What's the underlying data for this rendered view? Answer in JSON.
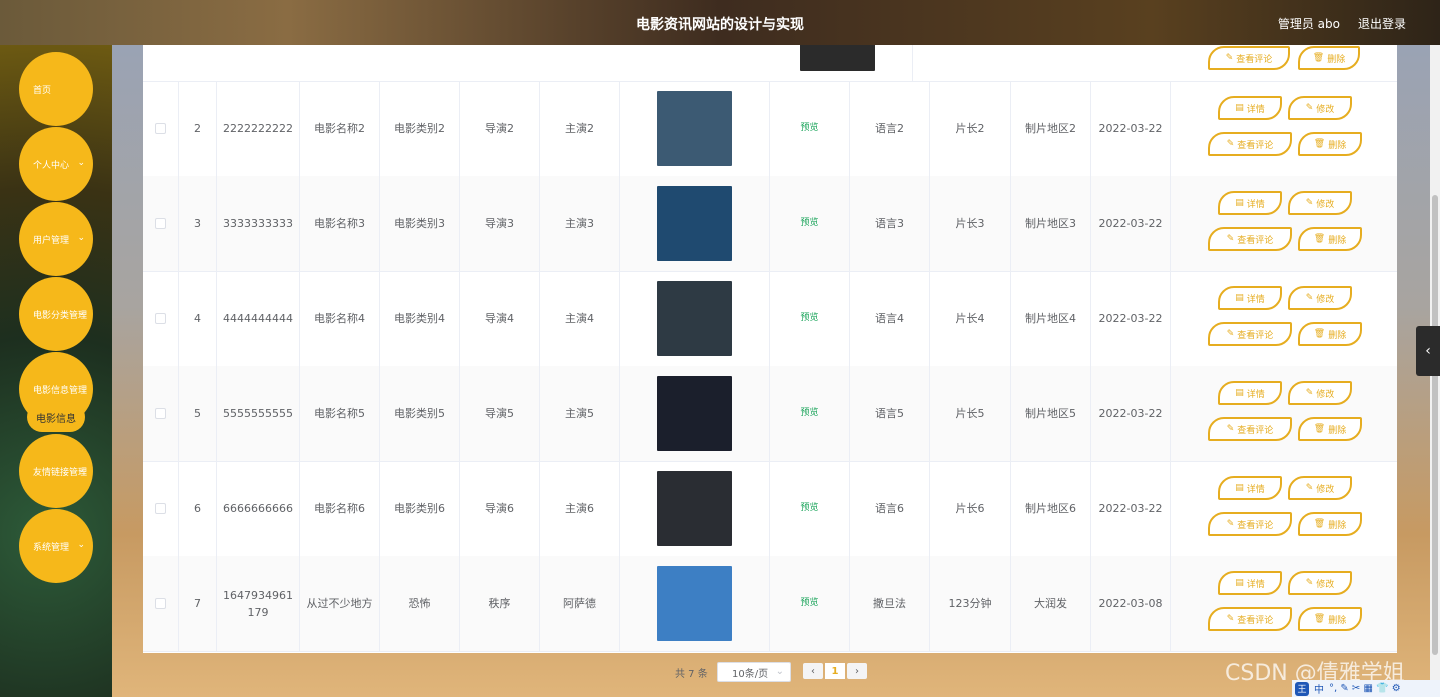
{
  "header": {
    "title": "电影资讯网站的设计与实现",
    "admin": "管理员 abo",
    "logout": "退出登录"
  },
  "sidebar": {
    "items": [
      {
        "label": "首页"
      },
      {
        "label": "个人中心"
      },
      {
        "label": "用户管理"
      },
      {
        "label": "电影分类管理"
      },
      {
        "label": "电影信息管理"
      },
      {
        "label": "友情链接管理"
      },
      {
        "label": "系统管理"
      }
    ],
    "sub_label": "电影信息"
  },
  "table": {
    "preview_text": "预览",
    "buttons": {
      "detail": "详情",
      "edit": "修改",
      "comments": "查看评论",
      "delete": "删除"
    },
    "rows": [
      {
        "idx": "2",
        "id": "2222222222",
        "name": "电影名称2",
        "category": "电影类别2",
        "director": "导演2",
        "actor": "主演2",
        "language": "语言2",
        "length": "片长2",
        "region": "制片地区2",
        "date": "2022-03-22",
        "poster_color": "#3c5a73"
      },
      {
        "idx": "3",
        "id": "3333333333",
        "name": "电影名称3",
        "category": "电影类别3",
        "director": "导演3",
        "actor": "主演3",
        "language": "语言3",
        "length": "片长3",
        "region": "制片地区3",
        "date": "2022-03-22",
        "poster_color": "#1f4a70"
      },
      {
        "idx": "4",
        "id": "4444444444",
        "name": "电影名称4",
        "category": "电影类别4",
        "director": "导演4",
        "actor": "主演4",
        "language": "语言4",
        "length": "片长4",
        "region": "制片地区4",
        "date": "2022-03-22",
        "poster_color": "#2e3a44"
      },
      {
        "idx": "5",
        "id": "5555555555",
        "name": "电影名称5",
        "category": "电影类别5",
        "director": "导演5",
        "actor": "主演5",
        "language": "语言5",
        "length": "片长5",
        "region": "制片地区5",
        "date": "2022-03-22",
        "poster_color": "#1b1f2c"
      },
      {
        "idx": "6",
        "id": "6666666666",
        "name": "电影名称6",
        "category": "电影类别6",
        "director": "导演6",
        "actor": "主演6",
        "language": "语言6",
        "length": "片长6",
        "region": "制片地区6",
        "date": "2022-03-22",
        "poster_color": "#2a2d33"
      },
      {
        "idx": "7",
        "id": "1647934961 179",
        "name": "从过不少地方",
        "category": "恐怖",
        "director": "秩序",
        "actor": "阿萨德",
        "language": "撒旦法",
        "length": "123分钟",
        "region": "大润发",
        "date": "2022-03-08",
        "poster_color": "#3d7fc4"
      }
    ]
  },
  "pagination": {
    "total": "共 7 条",
    "page_size": "10条/页",
    "prev": "‹",
    "current": "1",
    "next": "›"
  },
  "watermark": "CSDN @倩雅学姐",
  "tray": {
    "logo": "王",
    "lang": "中",
    "icons": "°, ✎ ✂ ▦ 👕 ⚙"
  }
}
